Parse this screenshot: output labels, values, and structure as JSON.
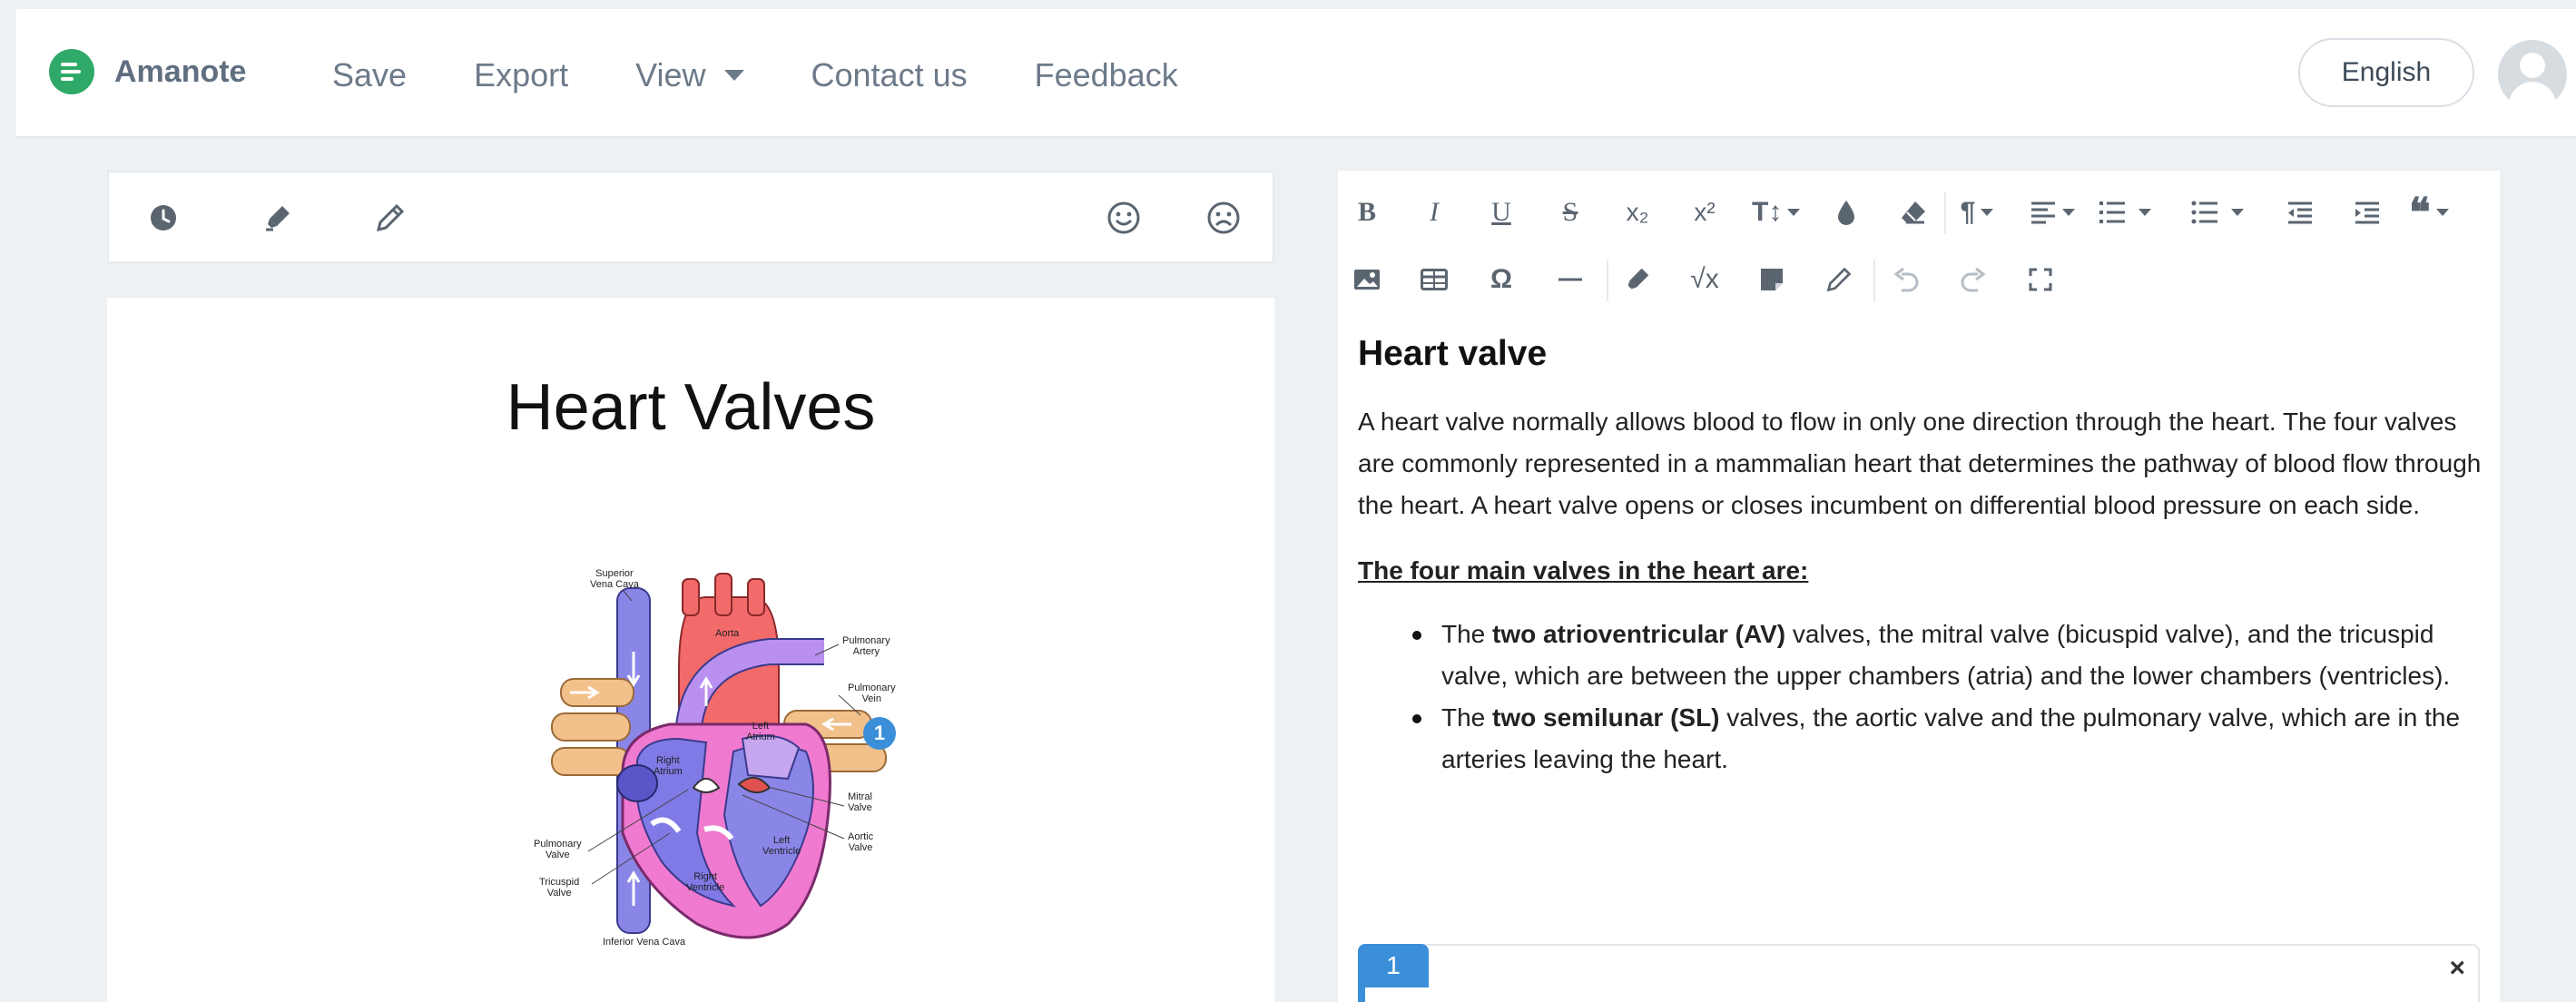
{
  "header": {
    "brand": "Amanote",
    "nav": [
      "Save",
      "Export",
      "View",
      "Contact us",
      "Feedback"
    ],
    "language": "English"
  },
  "left": {
    "toolbar_icons": [
      "clock-icon",
      "highlighter-icon",
      "pencil-icon",
      "smile-icon",
      "frown-icon"
    ],
    "slide_title": "Heart Valves",
    "diagram_labels": {
      "superior_vena_cava": "Superior\nVena Cava",
      "aorta": "Aorta",
      "pulmonary_artery": "Pulmonary\nArtery",
      "pulmonary_vein": "Pulmonary\nVein",
      "left_atrium": "Left\nAtrium",
      "right_atrium": "Right\nAtrium",
      "mitral_valve": "Mitral\nValve",
      "aortic_valve": "Aortic\nValve",
      "pulmonary_valve": "Pulmonary\nValve",
      "left_ventricle": "Left\nVentricle",
      "right_ventricle": "Right\nVentricle",
      "tricuspid_valve": "Tricuspid\nValve",
      "inferior_vena_cava": "Inferior Vena Cava"
    },
    "marker": "1"
  },
  "editor": {
    "toolbar_row1": [
      "B",
      "I",
      "U",
      "S",
      "x₂",
      "x²",
      "T↕",
      "color",
      "eraser",
      "¶",
      "align",
      "ol",
      "ul",
      "outdent",
      "indent",
      "quote"
    ],
    "heading": "Heart valve",
    "paragraph": "A heart valve normally allows blood to flow in only one direction through the heart. The four valves are commonly represented in a mammalian heart that determines the pathway of blood flow through the heart. A heart valve opens or closes incumbent on differential blood pressure on each side.",
    "subheading": "The four main valves in the heart are:",
    "bullets": [
      {
        "pre": "The ",
        "bold": "two atrioventricular (AV)",
        "post": " valves, the mitral valve (bicuspid valve), and the tricuspid valve, which are between the upper chambers (atria) and the lower chambers (ventricles)."
      },
      {
        "pre": "The ",
        "bold": "two semilunar (SL)",
        "post": " valves, the aortic valve and the pulmonary valve, which are in the arteries leaving the heart."
      }
    ],
    "note_number": "1",
    "note_close": "×"
  },
  "colors": {
    "brand_green": "#2fa968",
    "accent_blue": "#3a8fd8",
    "background": "#eef1f4"
  }
}
